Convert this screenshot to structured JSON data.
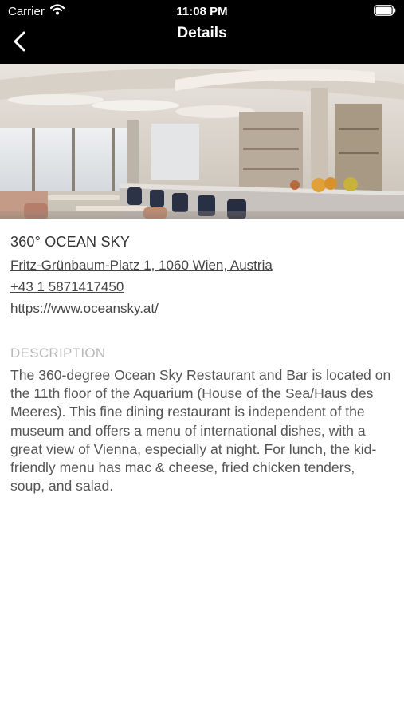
{
  "status_bar": {
    "carrier": "Carrier",
    "time": "11:08 PM"
  },
  "nav": {
    "title": "Details",
    "back_icon": "chevron-left-icon"
  },
  "hero_image": {
    "alt": "restaurant interior photo"
  },
  "place": {
    "name": "360° OCEAN SKY",
    "address": "Fritz-Grünbaum-Platz 1, 1060 Wien, Austria",
    "phone": "+43 1 5871417450",
    "website": "https://www.oceansky.at/"
  },
  "description": {
    "heading": "DESCRIPTION",
    "body": "The 360-degree Ocean Sky Restaurant and Bar is located on the 11th floor of the Aquarium (House of the Sea/Haus des Meeres). This fine dining restaurant is independent of the museum and offers a menu of international dishes, with a great view of Vienna, especially at night.  For lunch, the kid-friendly menu has mac & cheese, fried chicken tenders, soup, and salad."
  },
  "colors": {
    "nav_bg": "#000000",
    "text": "#444444",
    "muted": "#b8b8b8"
  }
}
